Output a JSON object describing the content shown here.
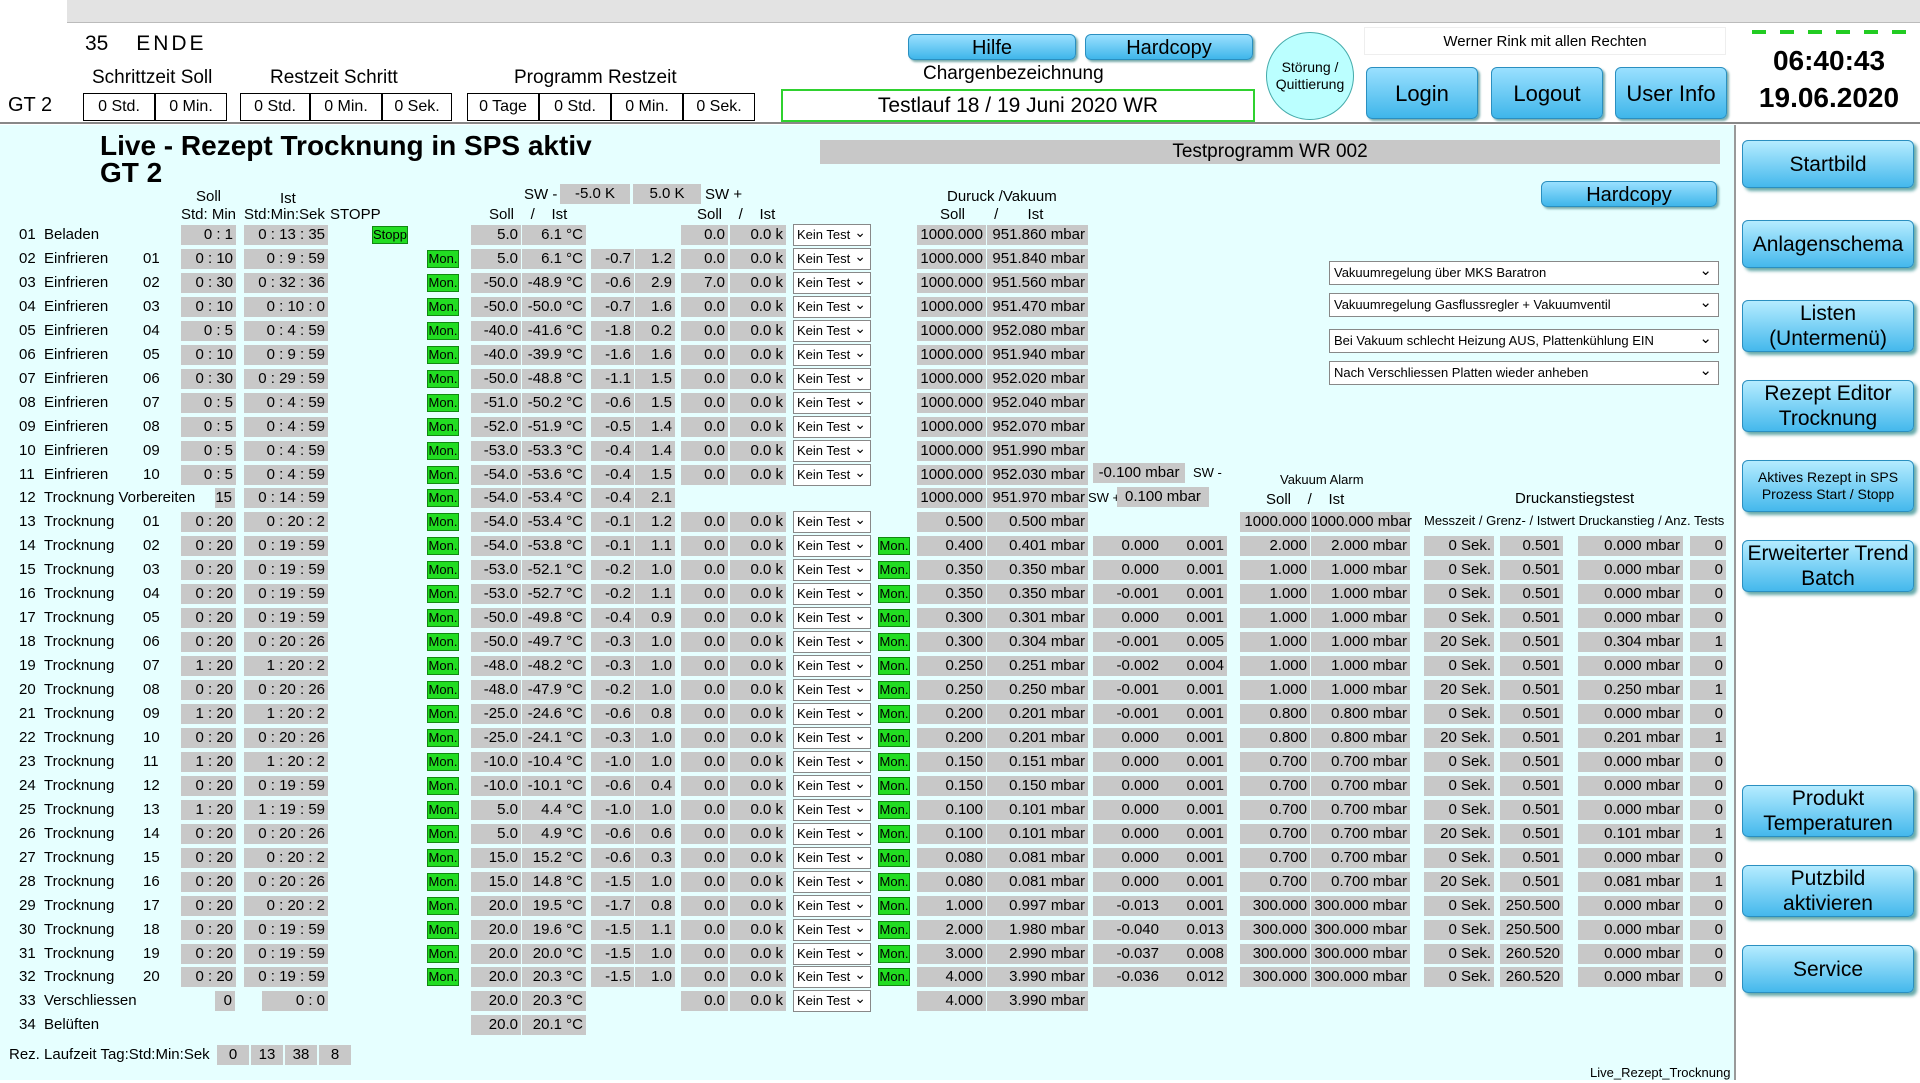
{
  "header": {
    "step_no": "35",
    "step_name": "ENDE",
    "gt": "GT 2",
    "schrittzeit_label": "Schrittzeit Soll",
    "restzeit_schritt_label": "Restzeit Schritt",
    "programm_restzeit_label": "Programm Restzeit",
    "schrittzeit": [
      "0 Std.",
      "0 Min."
    ],
    "restzeit_schritt": [
      "0 Std.",
      "0 Min.",
      "0 Sek."
    ],
    "programm_restzeit": [
      "0 Tage",
      "0 Std.",
      "0 Min.",
      "0 Sek."
    ],
    "hilfe": "Hilfe",
    "hardcopy": "Hardcopy",
    "chargen_label": "Chargenbezeichnung",
    "chargen_value": "Testlauf 18 / 19 Juni 2020 WR",
    "stoerung": "Störung / Quittierung",
    "user": "Werner Rink mit allen Rechten",
    "login": "Login",
    "logout": "Logout",
    "userinfo": "User Info",
    "time": "06:40:43",
    "date": "19.06.2020"
  },
  "main": {
    "title": "Live - Rezept Trocknung in SPS aktiv",
    "subtitle": "GT 2",
    "program": "Testprogramm WR 002",
    "hardcopy": "Hardcopy",
    "h_soll": "Soll",
    "h_ist": "Ist",
    "h_stdmin": "Std: Min",
    "h_stdminsek": "Std:Min:Sek",
    "h_stopp": "STOPP",
    "h_sw_minus": "SW -",
    "sw_minus_val": "-5.0 K",
    "sw_plus_val": "5.0 K",
    "h_sw_plus": "SW +",
    "h_soll_ist_temp": "Soll    /    Ist",
    "h_soll_ist_2": "Soll    /    Ist",
    "h_druck": "Duruck /Vakuum",
    "h_druck_soll_ist": "Soll       /       Ist",
    "h_vak_alarm": "Vakuum Alarm",
    "h_vak_soll_ist": "Soll    /    Ist",
    "h_druckanstieg": "Druckanstiegstest",
    "h_druckanstieg_sub": "Messzeit / Grenz- / Istwert Druckanstieg / Anz. Tests",
    "sw_minus_mbar": "-0.100 mbar",
    "sw_minus_lbl": "SW -",
    "sw_plus_lbl": "SW +",
    "sw_plus_mbar": "0.100 mbar",
    "dropdowns": [
      "Vakuumregelung über MKS Baratron",
      "Vakuumregelung Gasflussregler + Vakuumventil",
      "Bei Vakuum schlecht Heizung AUS, Plattenkühlung EIN",
      "Nach Verschliessen Platten wieder anheben"
    ],
    "runtime_label": "Rez. Laufzeit Tag:Std:Min:Sek",
    "runtime": [
      "0",
      "13",
      "38",
      "8"
    ],
    "footer": "Live_Rezept_Trocknung",
    "stopp": "Stopp",
    "mon": "Mon.",
    "kein": "Kein Test"
  },
  "rows": [
    {
      "n": "01",
      "name": "Beladen",
      "idx": "",
      "soll": "0 :  1",
      "ist": "0 : 13 : 35",
      "stopp": true,
      "mon": false,
      "ts": "5.0",
      "ti": "6.1 °C",
      "a": "",
      "b": "",
      "c": "0.0",
      "d": "0.0 k",
      "sel": true,
      "ps": "1000.000",
      "pi": "951.860 mbar"
    },
    {
      "n": "02",
      "name": "Einfrieren",
      "idx": "01",
      "soll": "0 : 10",
      "ist": "0 :  9 : 59",
      "mon": true,
      "ts": "5.0",
      "ti": "6.1 °C",
      "a": "-0.7",
      "b": "1.2",
      "c": "0.0",
      "d": "0.0 k",
      "sel": true,
      "ps": "1000.000",
      "pi": "951.840 mbar"
    },
    {
      "n": "03",
      "name": "Einfrieren",
      "idx": "02",
      "soll": "0 : 30",
      "ist": "0 : 32 : 36",
      "mon": true,
      "ts": "-50.0",
      "ti": "-48.9 °C",
      "a": "-0.6",
      "b": "2.9",
      "c": "7.0",
      "d": "0.0 k",
      "sel": true,
      "ps": "1000.000",
      "pi": "951.560 mbar"
    },
    {
      "n": "04",
      "name": "Einfrieren",
      "idx": "03",
      "soll": "0 : 10",
      "ist": "0 : 10 :  0",
      "mon": true,
      "ts": "-50.0",
      "ti": "-50.0 °C",
      "a": "-0.7",
      "b": "1.6",
      "c": "0.0",
      "d": "0.0 k",
      "sel": true,
      "ps": "1000.000",
      "pi": "951.470 mbar"
    },
    {
      "n": "05",
      "name": "Einfrieren",
      "idx": "04",
      "soll": "0 :  5",
      "ist": "0 :  4 : 59",
      "mon": true,
      "ts": "-40.0",
      "ti": "-41.6 °C",
      "a": "-1.8",
      "b": "0.2",
      "c": "0.0",
      "d": "0.0 k",
      "sel": true,
      "ps": "1000.000",
      "pi": "952.080 mbar"
    },
    {
      "n": "06",
      "name": "Einfrieren",
      "idx": "05",
      "soll": "0 : 10",
      "ist": "0 :  9 : 59",
      "mon": true,
      "ts": "-40.0",
      "ti": "-39.9 °C",
      "a": "-1.6",
      "b": "1.6",
      "c": "0.0",
      "d": "0.0 k",
      "sel": true,
      "ps": "1000.000",
      "pi": "951.940 mbar"
    },
    {
      "n": "07",
      "name": "Einfrieren",
      "idx": "06",
      "soll": "0 : 30",
      "ist": "0 : 29 : 59",
      "mon": true,
      "ts": "-50.0",
      "ti": "-48.8 °C",
      "a": "-1.1",
      "b": "1.5",
      "c": "0.0",
      "d": "0.0 k",
      "sel": true,
      "ps": "1000.000",
      "pi": "952.020 mbar"
    },
    {
      "n": "08",
      "name": "Einfrieren",
      "idx": "07",
      "soll": "0 :  5",
      "ist": "0 :  4 : 59",
      "mon": true,
      "ts": "-51.0",
      "ti": "-50.2 °C",
      "a": "-0.6",
      "b": "1.5",
      "c": "0.0",
      "d": "0.0 k",
      "sel": true,
      "ps": "1000.000",
      "pi": "952.040 mbar"
    },
    {
      "n": "09",
      "name": "Einfrieren",
      "idx": "08",
      "soll": "0 :  5",
      "ist": "0 :  4 : 59",
      "mon": true,
      "ts": "-52.0",
      "ti": "-51.9 °C",
      "a": "-0.5",
      "b": "1.4",
      "c": "0.0",
      "d": "0.0 k",
      "sel": true,
      "ps": "1000.000",
      "pi": "952.070 mbar"
    },
    {
      "n": "10",
      "name": "Einfrieren",
      "idx": "09",
      "soll": "0 :  5",
      "ist": "0 :  4 : 59",
      "mon": true,
      "ts": "-53.0",
      "ti": "-53.3 °C",
      "a": "-0.4",
      "b": "1.4",
      "c": "0.0",
      "d": "0.0 k",
      "sel": true,
      "ps": "1000.000",
      "pi": "951.990 mbar"
    },
    {
      "n": "11",
      "name": "Einfrieren",
      "idx": "10",
      "soll": "0 :  5",
      "ist": "0 :  4 : 59",
      "mon": true,
      "ts": "-54.0",
      "ti": "-53.6 °C",
      "a": "-0.4",
      "b": "1.5",
      "c": "0.0",
      "d": "0.0 k",
      "sel": true,
      "ps": "1000.000",
      "pi": "952.030 mbar"
    },
    {
      "n": "12",
      "name": "Trocknung Vorbereiten",
      "idx": "",
      "soll": "15",
      "ist": "0 : 14 : 59",
      "mon": true,
      "ts": "-54.0",
      "ti": "-53.4 °C",
      "a": "-0.4",
      "b": "2.1",
      "c": "",
      "d": "",
      "sel": false,
      "ps": "1000.000",
      "pi": "951.970 mbar"
    },
    {
      "n": "13",
      "name": "Trocknung",
      "idx": "01",
      "soll": "0 : 20",
      "ist": "0 : 20 :  2",
      "mon": true,
      "ts": "-54.0",
      "ti": "-53.4 °C",
      "a": "-0.1",
      "b": "1.2",
      "c": "0.0",
      "d": "0.0 k",
      "sel": true,
      "ps": "0.500",
      "pi": "0.500 mbar",
      "vs": "1000.000",
      "vi": "1000.000 mbar"
    },
    {
      "n": "14",
      "name": "Trocknung",
      "idx": "02",
      "soll": "0 : 20",
      "ist": "0 : 19 : 59",
      "mon": true,
      "ts": "-54.0",
      "ti": "-53.8 °C",
      "a": "-0.1",
      "b": "1.1",
      "c": "0.0",
      "d": "0.0 k",
      "sel": true,
      "mon2": true,
      "ps": "0.400",
      "pi": "0.401 mbar",
      "e": "0.000",
      "f": "0.001",
      "vs": "2.000",
      "vi": "2.000 mbar",
      "dm": "0 Sek.",
      "dg": "0.501",
      "di": "0.000 mbar",
      "da": "0"
    },
    {
      "n": "15",
      "name": "Trocknung",
      "idx": "03",
      "soll": "0 : 20",
      "ist": "0 : 19 : 59",
      "mon": true,
      "ts": "-53.0",
      "ti": "-52.1 °C",
      "a": "-0.2",
      "b": "1.0",
      "c": "0.0",
      "d": "0.0 k",
      "sel": true,
      "mon2": true,
      "ps": "0.350",
      "pi": "0.350 mbar",
      "e": "0.000",
      "f": "0.001",
      "vs": "1.000",
      "vi": "1.000 mbar",
      "dm": "0 Sek.",
      "dg": "0.501",
      "di": "0.000 mbar",
      "da": "0"
    },
    {
      "n": "16",
      "name": "Trocknung",
      "idx": "04",
      "soll": "0 : 20",
      "ist": "0 : 19 : 59",
      "mon": true,
      "ts": "-53.0",
      "ti": "-52.7 °C",
      "a": "-0.2",
      "b": "1.1",
      "c": "0.0",
      "d": "0.0 k",
      "sel": true,
      "mon2": true,
      "ps": "0.350",
      "pi": "0.350 mbar",
      "e": "-0.001",
      "f": "0.001",
      "vs": "1.000",
      "vi": "1.000 mbar",
      "dm": "0 Sek.",
      "dg": "0.501",
      "di": "0.000 mbar",
      "da": "0"
    },
    {
      "n": "17",
      "name": "Trocknung",
      "idx": "05",
      "soll": "0 : 20",
      "ist": "0 : 19 : 59",
      "mon": true,
      "ts": "-50.0",
      "ti": "-49.8 °C",
      "a": "-0.4",
      "b": "0.9",
      "c": "0.0",
      "d": "0.0 k",
      "sel": true,
      "mon2": true,
      "ps": "0.300",
      "pi": "0.301 mbar",
      "e": "0.000",
      "f": "0.001",
      "vs": "1.000",
      "vi": "1.000 mbar",
      "dm": "0 Sek.",
      "dg": "0.501",
      "di": "0.000 mbar",
      "da": "0"
    },
    {
      "n": "18",
      "name": "Trocknung",
      "idx": "06",
      "soll": "0 : 20",
      "ist": "0 : 20 : 26",
      "mon": true,
      "ts": "-50.0",
      "ti": "-49.7 °C",
      "a": "-0.3",
      "b": "1.0",
      "c": "0.0",
      "d": "0.0 k",
      "sel": true,
      "mon2": true,
      "ps": "0.300",
      "pi": "0.304 mbar",
      "e": "-0.001",
      "f": "0.005",
      "vs": "1.000",
      "vi": "1.000 mbar",
      "dm": "20 Sek.",
      "dg": "0.501",
      "di": "0.304 mbar",
      "da": "1"
    },
    {
      "n": "19",
      "name": "Trocknung",
      "idx": "07",
      "soll": "1 : 20",
      "ist": "1 : 20 :  2",
      "mon": true,
      "ts": "-48.0",
      "ti": "-48.2 °C",
      "a": "-0.3",
      "b": "1.0",
      "c": "0.0",
      "d": "0.0 k",
      "sel": true,
      "mon2": true,
      "ps": "0.250",
      "pi": "0.251 mbar",
      "e": "-0.002",
      "f": "0.004",
      "vs": "1.000",
      "vi": "1.000 mbar",
      "dm": "0 Sek.",
      "dg": "0.501",
      "di": "0.000 mbar",
      "da": "0"
    },
    {
      "n": "20",
      "name": "Trocknung",
      "idx": "08",
      "soll": "0 : 20",
      "ist": "0 : 20 : 26",
      "mon": true,
      "ts": "-48.0",
      "ti": "-47.9 °C",
      "a": "-0.2",
      "b": "1.0",
      "c": "0.0",
      "d": "0.0 k",
      "sel": true,
      "mon2": true,
      "ps": "0.250",
      "pi": "0.250 mbar",
      "e": "-0.001",
      "f": "0.001",
      "vs": "1.000",
      "vi": "1.000 mbar",
      "dm": "20 Sek.",
      "dg": "0.501",
      "di": "0.250 mbar",
      "da": "1"
    },
    {
      "n": "21",
      "name": "Trocknung",
      "idx": "09",
      "soll": "1 : 20",
      "ist": "1 : 20 :  2",
      "mon": true,
      "ts": "-25.0",
      "ti": "-24.6 °C",
      "a": "-0.6",
      "b": "0.8",
      "c": "0.0",
      "d": "0.0 k",
      "sel": true,
      "mon2": true,
      "ps": "0.200",
      "pi": "0.201 mbar",
      "e": "-0.001",
      "f": "0.001",
      "vs": "0.800",
      "vi": "0.800 mbar",
      "dm": "0 Sek.",
      "dg": "0.501",
      "di": "0.000 mbar",
      "da": "0"
    },
    {
      "n": "22",
      "name": "Trocknung",
      "idx": "10",
      "soll": "0 : 20",
      "ist": "0 : 20 : 26",
      "mon": true,
      "ts": "-25.0",
      "ti": "-24.1 °C",
      "a": "-0.3",
      "b": "1.0",
      "c": "0.0",
      "d": "0.0 k",
      "sel": true,
      "mon2": true,
      "ps": "0.200",
      "pi": "0.201 mbar",
      "e": "0.000",
      "f": "0.001",
      "vs": "0.800",
      "vi": "0.800 mbar",
      "dm": "20 Sek.",
      "dg": "0.501",
      "di": "0.201 mbar",
      "da": "1"
    },
    {
      "n": "23",
      "name": "Trocknung",
      "idx": "11",
      "soll": "1 : 20",
      "ist": "1 : 20 :  2",
      "mon": true,
      "ts": "-10.0",
      "ti": "-10.4 °C",
      "a": "-1.0",
      "b": "1.0",
      "c": "0.0",
      "d": "0.0 k",
      "sel": true,
      "mon2": true,
      "ps": "0.150",
      "pi": "0.151 mbar",
      "e": "0.000",
      "f": "0.001",
      "vs": "0.700",
      "vi": "0.700 mbar",
      "dm": "0 Sek.",
      "dg": "0.501",
      "di": "0.000 mbar",
      "da": "0"
    },
    {
      "n": "24",
      "name": "Trocknung",
      "idx": "12",
      "soll": "0 : 20",
      "ist": "0 : 19 : 59",
      "mon": true,
      "ts": "-10.0",
      "ti": "-10.1 °C",
      "a": "-0.6",
      "b": "0.4",
      "c": "0.0",
      "d": "0.0 k",
      "sel": true,
      "mon2": true,
      "ps": "0.150",
      "pi": "0.150 mbar",
      "e": "0.000",
      "f": "0.001",
      "vs": "0.700",
      "vi": "0.700 mbar",
      "dm": "0 Sek.",
      "dg": "0.501",
      "di": "0.000 mbar",
      "da": "0"
    },
    {
      "n": "25",
      "name": "Trocknung",
      "idx": "13",
      "soll": "1 : 20",
      "ist": "1 : 19 : 59",
      "mon": true,
      "ts": "5.0",
      "ti": "4.4 °C",
      "a": "-1.0",
      "b": "1.0",
      "c": "0.0",
      "d": "0.0 k",
      "sel": true,
      "mon2": true,
      "ps": "0.100",
      "pi": "0.101 mbar",
      "e": "0.000",
      "f": "0.001",
      "vs": "0.700",
      "vi": "0.700 mbar",
      "dm": "0 Sek.",
      "dg": "0.501",
      "di": "0.000 mbar",
      "da": "0"
    },
    {
      "n": "26",
      "name": "Trocknung",
      "idx": "14",
      "soll": "0 : 20",
      "ist": "0 : 20 : 26",
      "mon": true,
      "ts": "5.0",
      "ti": "4.9 °C",
      "a": "-0.6",
      "b": "0.6",
      "c": "0.0",
      "d": "0.0 k",
      "sel": true,
      "mon2": true,
      "ps": "0.100",
      "pi": "0.101 mbar",
      "e": "0.000",
      "f": "0.001",
      "vs": "0.700",
      "vi": "0.700 mbar",
      "dm": "20 Sek.",
      "dg": "0.501",
      "di": "0.101 mbar",
      "da": "1"
    },
    {
      "n": "27",
      "name": "Trocknung",
      "idx": "15",
      "soll": "0 : 20",
      "ist": "0 : 20 :  2",
      "mon": true,
      "ts": "15.0",
      "ti": "15.2 °C",
      "a": "-0.6",
      "b": "0.3",
      "c": "0.0",
      "d": "0.0 k",
      "sel": true,
      "mon2": true,
      "ps": "0.080",
      "pi": "0.081 mbar",
      "e": "0.000",
      "f": "0.001",
      "vs": "0.700",
      "vi": "0.700 mbar",
      "dm": "0 Sek.",
      "dg": "0.501",
      "di": "0.000 mbar",
      "da": "0"
    },
    {
      "n": "28",
      "name": "Trocknung",
      "idx": "16",
      "soll": "0 : 20",
      "ist": "0 : 20 : 26",
      "mon": true,
      "ts": "15.0",
      "ti": "14.8 °C",
      "a": "-1.5",
      "b": "1.0",
      "c": "0.0",
      "d": "0.0 k",
      "sel": true,
      "mon2": true,
      "ps": "0.080",
      "pi": "0.081 mbar",
      "e": "0.000",
      "f": "0.001",
      "vs": "0.700",
      "vi": "0.700 mbar",
      "dm": "20 Sek.",
      "dg": "0.501",
      "di": "0.081 mbar",
      "da": "1"
    },
    {
      "n": "29",
      "name": "Trocknung",
      "idx": "17",
      "soll": "0 : 20",
      "ist": "0 : 20 :  2",
      "mon": true,
      "ts": "20.0",
      "ti": "19.5 °C",
      "a": "-1.7",
      "b": "0.8",
      "c": "0.0",
      "d": "0.0 k",
      "sel": true,
      "mon2": true,
      "ps": "1.000",
      "pi": "0.997 mbar",
      "e": "-0.013",
      "f": "0.001",
      "vs": "300.000",
      "vi": "300.000 mbar",
      "dm": "0 Sek.",
      "dg": "250.500",
      "di": "0.000 mbar",
      "da": "0"
    },
    {
      "n": "30",
      "name": "Trocknung",
      "idx": "18",
      "soll": "0 : 20",
      "ist": "0 : 19 : 59",
      "mon": true,
      "ts": "20.0",
      "ti": "19.6 °C",
      "a": "-1.5",
      "b": "1.1",
      "c": "0.0",
      "d": "0.0 k",
      "sel": true,
      "mon2": true,
      "ps": "2.000",
      "pi": "1.980 mbar",
      "e": "-0.040",
      "f": "0.013",
      "vs": "300.000",
      "vi": "300.000 mbar",
      "dm": "0 Sek.",
      "dg": "250.500",
      "di": "0.000 mbar",
      "da": "0"
    },
    {
      "n": "31",
      "name": "Trocknung",
      "idx": "19",
      "soll": "0 : 20",
      "ist": "0 : 19 : 59",
      "mon": true,
      "ts": "20.0",
      "ti": "20.0 °C",
      "a": "-1.5",
      "b": "1.0",
      "c": "0.0",
      "d": "0.0 k",
      "sel": true,
      "mon2": true,
      "ps": "3.000",
      "pi": "2.990 mbar",
      "e": "-0.037",
      "f": "0.008",
      "vs": "300.000",
      "vi": "300.000 mbar",
      "dm": "0 Sek.",
      "dg": "260.520",
      "di": "0.000 mbar",
      "da": "0"
    },
    {
      "n": "32",
      "name": "Trocknung",
      "idx": "20",
      "soll": "0 : 20",
      "ist": "0 : 19 : 59",
      "mon": true,
      "ts": "20.0",
      "ti": "20.3 °C",
      "a": "-1.5",
      "b": "1.0",
      "c": "0.0",
      "d": "0.0 k",
      "sel": true,
      "mon2": true,
      "ps": "4.000",
      "pi": "3.990 mbar",
      "e": "-0.036",
      "f": "0.012",
      "vs": "300.000",
      "vi": "300.000 mbar",
      "dm": "0 Sek.",
      "dg": "260.520",
      "di": "0.000 mbar",
      "da": "0"
    },
    {
      "n": "33",
      "name": "Verschliessen",
      "idx": "",
      "soll": "0",
      "ist": "0 :  0",
      "mon": false,
      "ts": "20.0",
      "ti": "20.3 °C",
      "a": "",
      "b": "",
      "c": "0.0",
      "d": "0.0 k",
      "sel": true,
      "ps": "4.000",
      "pi": "3.990 mbar"
    },
    {
      "n": "34",
      "name": "Belüften",
      "idx": "",
      "soll": "",
      "ist": "",
      "mon": false,
      "ts": "20.0",
      "ti": "20.1 °C",
      "a": "",
      "b": "",
      "c": "",
      "d": "",
      "sel": false,
      "ps": "",
      "pi": ""
    }
  ],
  "sidebar": [
    "Startbild",
    "Anlagenschema",
    "Listen\n(Untermenü)",
    "Rezept Editor\nTrocknung",
    "Aktives Rezept in SPS\nProzess Start / Stopp",
    "Erweiterter Trend\nBatch",
    "Produkt\nTemperaturen",
    "Putzbild\naktivieren",
    "Service"
  ]
}
